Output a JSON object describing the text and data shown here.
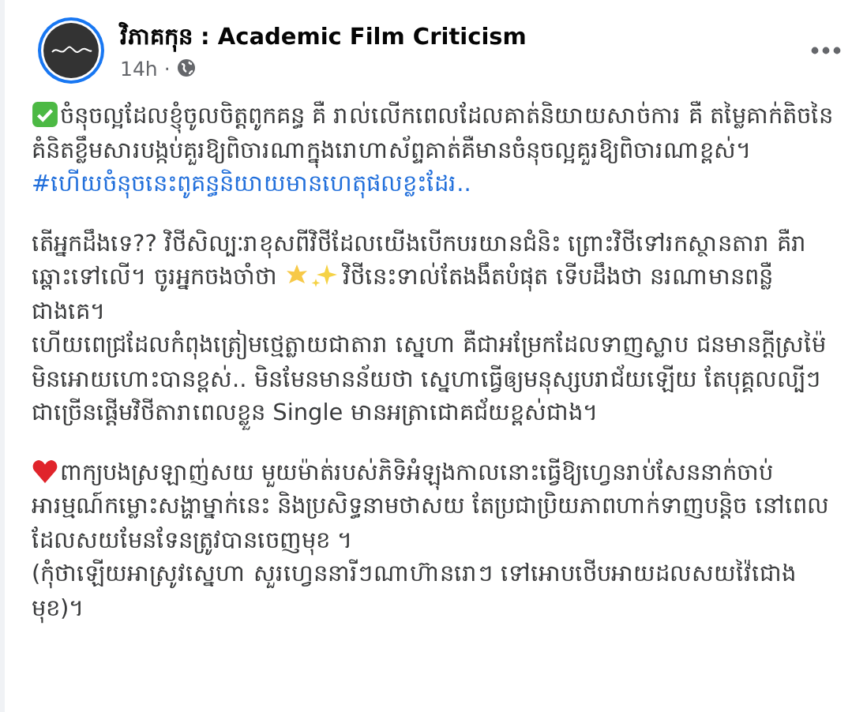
{
  "post": {
    "author": "វិភាគកុន : Academic Film Criticism",
    "time": "14h",
    "separator": "·",
    "paragraphs": [
      {
        "kind": "check",
        "text": "ចំនុចល្អដែលខ្ញុំចូលចិត្តពូកគន្ធ គឺ រាល់លើកពេលដែលគាត់និយាយសាច់ការ គឺ តម្លៃគាក់តិចនៃគំនិតខ្លឹមសារបង្កប់គួរឱ្យពិចារណាក្នុងរោហាស័ព្ទគាត់គឺមានចំនុចល្អគួរឱ្យពិចារណាខ្ពស់។"
      },
      {
        "kind": "hashtag",
        "text": "#ហើយចំនុចនេះពូគន្ធនិយាយមានហេតុផលខ្លះដែរ.."
      },
      {
        "kind": "sparkle",
        "text": "តើអ្នកដឹងទេ?? វិថីសិល្បៈរាខុសពីវិថីដែលយើងបើកបរយានជំនិះ ព្រោះវិថីទៅរកស្ថានតារា គឺរាឆ្ពោះទៅលើ។ ចូរអ្នកចងចាំថា ",
        "text_after": "វិថីនេះទាល់តែងងឹតបំផុត ទើបដឹងថា នរណាមានពន្លឺជាងគេ។"
      },
      {
        "kind": "plain",
        "text": " ហើយពេជ្រដែលកំពុងត្រៀមថ្មេត្លាយជាតារា ស្នេហា គឺជាអម្រែកដែលទាញស្លាប ជនមានក្តីស្រម៉ៃមិនអោយហោះបានខ្ពស់..  មិនមែនមានន័យថា ស្នេហាធ្វើឲ្យមនុស្សបរាជ័យឡើយ តែបុគ្គលល្បីៗជាច្រើនផ្តើមវិថីតារាពេលខ្លួន Single  មានអត្រាជោគជ័យខ្ពស់ជាង។"
      },
      {
        "kind": "heart",
        "text": "ពាក្យបងស្រឡាញ់សយ មួយម៉ាត់របស់ភិទិអំឡុងកាលនោះធ្វើឱ្យហ្វេនរាប់សែននាក់ចាប់អារម្មណ៍កម្លោះសង្ហាម្នាក់នេះ និងប្រសិទ្ធនាមថាសយ តែប្រជាប្រិយភាពហាក់ទាញបន្តិច នៅពេលដែលសយមែនទែនត្រូវបានចេញមុខ ។"
      },
      {
        "kind": "plain",
        "text": "(កុំថាឡើយអាស្រូវស្នេហា សួរហ្វេននារីៗណាហ៊ានរោៗ ទៅអោបថើបអាយដលសយវ៉ៃជោងមុខ)។"
      }
    ]
  }
}
